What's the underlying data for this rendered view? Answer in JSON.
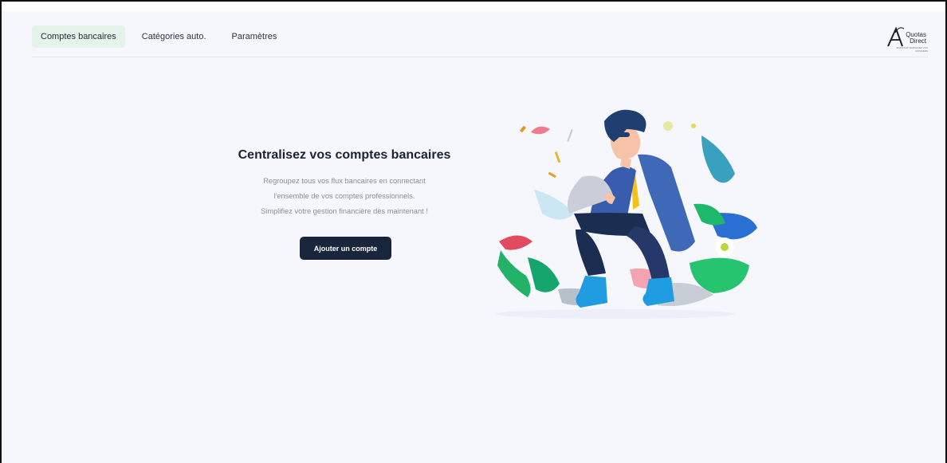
{
  "nav": {
    "tabs": [
      {
        "label": "Comptes bancaires",
        "active": true
      },
      {
        "label": "Catégories auto.",
        "active": false
      },
      {
        "label": "Paramètres",
        "active": false
      }
    ]
  },
  "brand": {
    "logo_title": "Quotas Direct",
    "logo_subtitle": "BOOST ET SIMPLIFIEZ VOS DOSSIERS",
    "accent_color": "#e4f4ea",
    "primary_color": "#18253b"
  },
  "hero": {
    "title": "Centralisez vos comptes bancaires",
    "description_lines": [
      "Regroupez tous vos flux bancaires en connectant",
      "l'ensemble de vos comptes professionnels.",
      "Simplifiez votre gestion financière dès maintenant !"
    ],
    "cta_label": "Ajouter un compte"
  }
}
